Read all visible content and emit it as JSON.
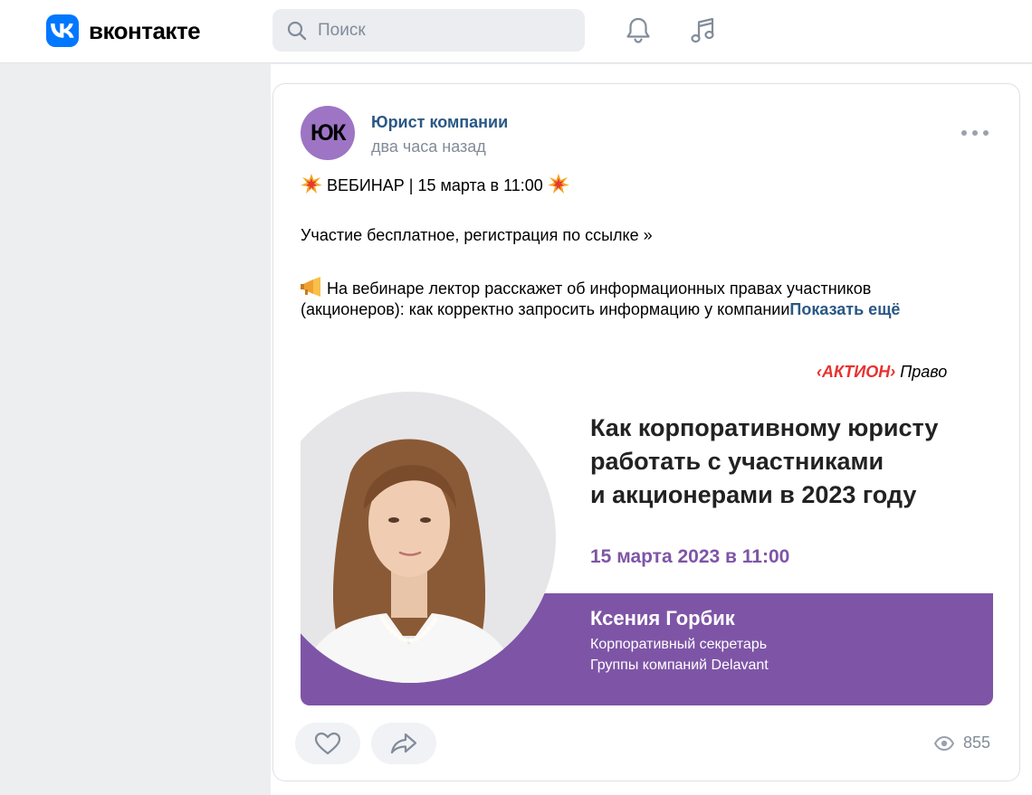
{
  "header": {
    "logo_text": "вконтакте",
    "search_placeholder": "Поиск",
    "accent": "#0077ff"
  },
  "post": {
    "author": "Юрист компании",
    "avatar_initials": "ЮК",
    "time": "два часа назад",
    "line1": "ВЕБИНАР | 15 марта в 11:00",
    "line2": "Участие бесплатное, регистрация по ссылке »",
    "line3_part1": "На вебинаре лектор расскажет об информационных правах участников",
    "line3_part2": "(акционеров): как корректно запросить информацию у компании",
    "show_more": "Показать ещё",
    "views": "855",
    "icons": {
      "like": "heart-icon",
      "share": "share-icon",
      "views": "eye-icon",
      "more": "more-icon"
    }
  },
  "banner": {
    "brand_red": "‹АКТИОН›",
    "brand_word": "Право",
    "title_line1": "Как корпоративному юристу",
    "title_line2": "работать с участниками",
    "title_line3": "и акционерами в 2023 году",
    "date": "15 марта 2023 в 11:00",
    "speaker_name": "Ксения Горбик",
    "speaker_role_line1": "Корпоративный секретарь",
    "speaker_role_line2": "Группы компаний Delavant",
    "accent": "#7e55a6"
  }
}
